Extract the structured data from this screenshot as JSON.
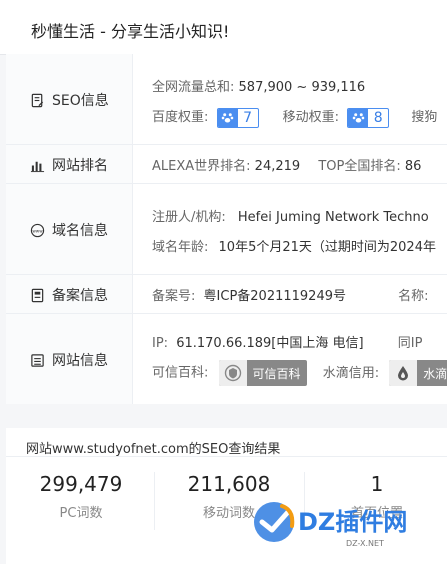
{
  "header": {
    "title": "秒懂生活 - 分享生活小知识!"
  },
  "rows": {
    "seo": {
      "label": "SEO信息",
      "traffic_label": "全网流量总和:",
      "traffic_value": "587,900 ~ 939,116",
      "baidu_label": "百度权重:",
      "baidu_value": "7",
      "mobile_label": "移动权重:",
      "mobile_value": "8",
      "sogou_label": "搜狗"
    },
    "rank": {
      "label": "网站排名",
      "alexa_label": "ALEXA世界排名:",
      "alexa_value": "24,219",
      "top_label": "TOP全国排名:",
      "top_value": "86"
    },
    "domain": {
      "label": "域名信息",
      "registrant_label": "注册人/机构:",
      "registrant_value": "Hefei Juming Network Techno",
      "age_label": "域名年龄:",
      "age_value": "10年5个月21天（过期时间为2024年"
    },
    "icp": {
      "label": "备案信息",
      "icp_label": "备案号:",
      "icp_value": "粤ICP备2021119249号",
      "name_label": "名称:"
    },
    "site": {
      "label": "网站信息",
      "ip_label": "IP:",
      "ip_value": "61.170.66.189[中国上海 电信]",
      "same_ip_label": "同IP",
      "trust_label": "可信百科:",
      "trust_badge": "可信百科",
      "water_label": "水滴信用:",
      "water_badge": "水滴"
    }
  },
  "seo_result": {
    "title": "网站www.studyofnet.com的SEO查询结果",
    "stats": [
      {
        "value": "299,479",
        "label": "PC词数"
      },
      {
        "value": "211,608",
        "label": "移动词数"
      },
      {
        "value": "1",
        "label": "首页位置"
      }
    ]
  },
  "watermark": {
    "brand": "DZ插件网",
    "url": "DZ-X.NET"
  },
  "colors": {
    "accent": "#4b8ef0",
    "watermark_blue": "#2f7de1",
    "watermark_orange": "#f39c12"
  }
}
